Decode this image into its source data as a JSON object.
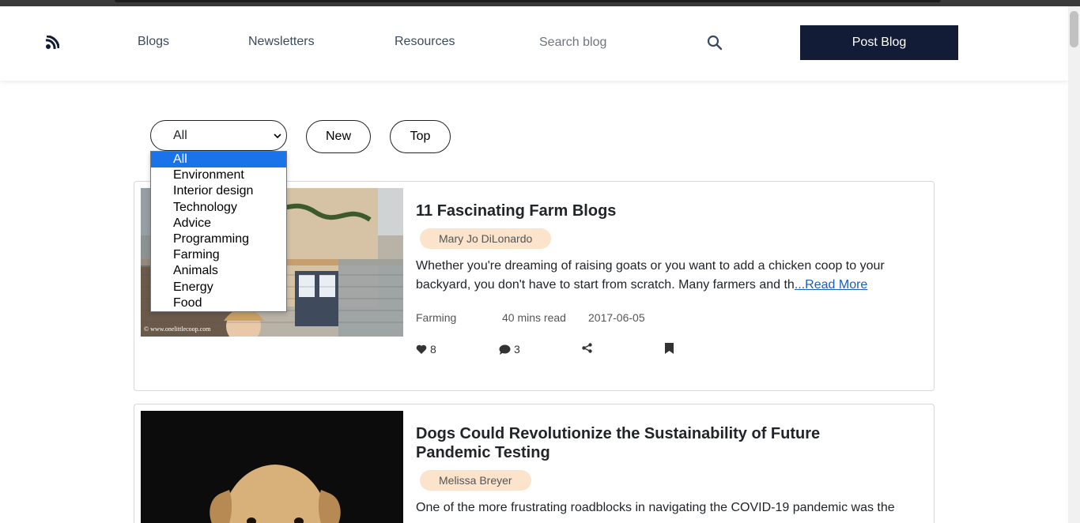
{
  "nav": {
    "links": [
      "Blogs",
      "Newsletters",
      "Resources"
    ],
    "search_placeholder": "Search blog",
    "post_button": "Post Blog"
  },
  "filters": {
    "selected": "All",
    "options": [
      "All",
      "Environment",
      "Interior design",
      "Technology",
      "Advice",
      "Programming",
      "Farming",
      "Animals",
      "Energy",
      "Food"
    ],
    "new_label": "New",
    "top_label": "Top"
  },
  "posts": [
    {
      "title": "11 Fascinating Farm Blogs",
      "author": "Mary Jo DiLonardo",
      "excerpt": "Whether you're dreaming of raising goats or you want to add a chicken coop to your backyard, you don't have to start from scratch. Many farmers and th",
      "read_more": "...Read More",
      "category": "Farming",
      "read_time": "40 mins read",
      "date": "2017-06-05",
      "likes": "8",
      "comments": "3",
      "image_watermark": "© www.onelittlecoop.com"
    },
    {
      "title": "Dogs Could Revolutionize the Sustainability of Future Pandemic Testing",
      "author": "Melissa Breyer",
      "excerpt": "One of the more frustrating roadblocks in navigating the COVID-19 pandemic was the"
    }
  ],
  "colors": {
    "primary_button": "#121c36",
    "author_badge": "#fbe3cc",
    "link": "#1a5fb4",
    "dropdown_highlight": "#1a73e8"
  }
}
